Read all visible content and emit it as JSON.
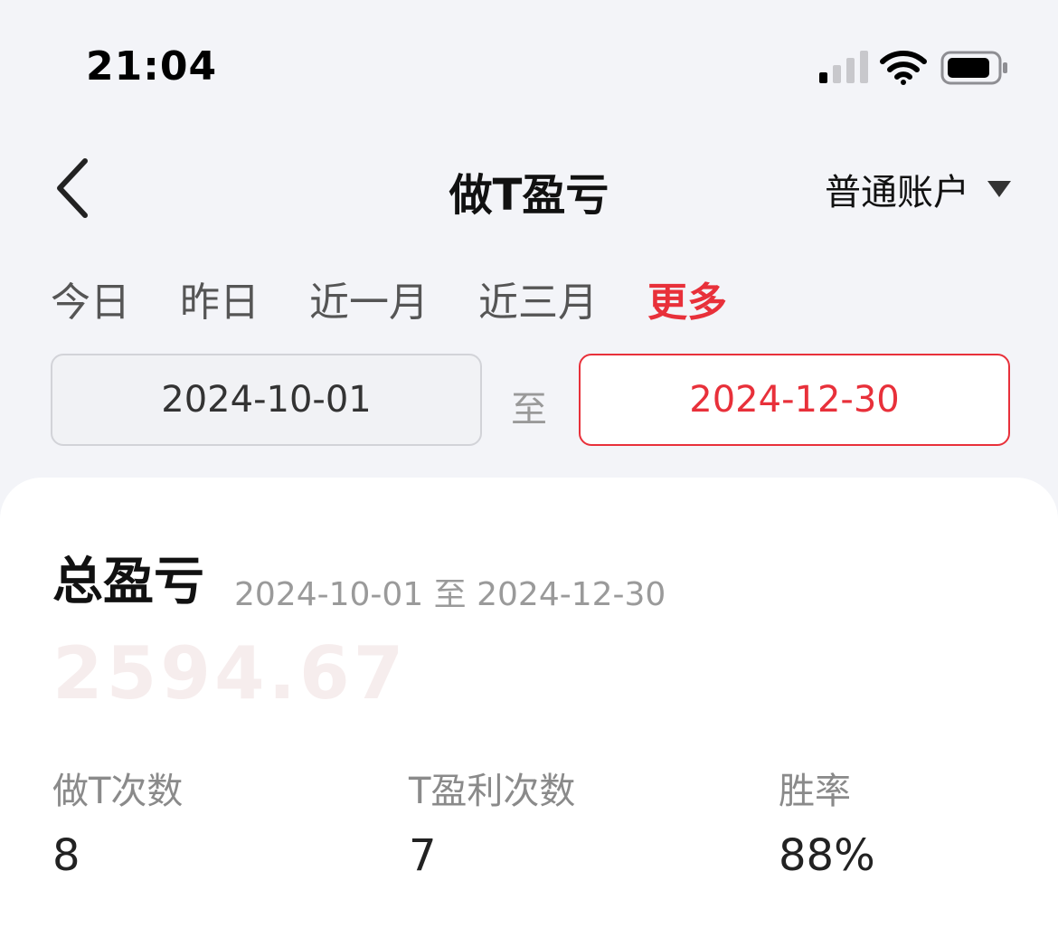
{
  "status_bar": {
    "time": "21:04",
    "icons": [
      "signal-icon",
      "wifi-icon",
      "battery-icon"
    ]
  },
  "nav": {
    "back_icon": "chevron-left-icon",
    "title": "做T盈亏",
    "account_label": "普通账户",
    "account_caret_icon": "caret-down-icon"
  },
  "range_tabs": [
    {
      "label": "今日",
      "active": false
    },
    {
      "label": "昨日",
      "active": false
    },
    {
      "label": "近一月",
      "active": false
    },
    {
      "label": "近三月",
      "active": false
    },
    {
      "label": "更多",
      "active": true
    }
  ],
  "date_range": {
    "start": "2024-10-01",
    "separator": "至",
    "end": "2024-12-30"
  },
  "summary": {
    "title": "总盈亏",
    "range_text": "2024-10-01 至 2024-12-30",
    "total_value": "2594.67",
    "stats": [
      {
        "label": "做T次数",
        "value": "8"
      },
      {
        "label": "T盈利次数",
        "value": "7"
      },
      {
        "label": "胜率",
        "value": "88%"
      }
    ]
  },
  "colors": {
    "accent": "#e8303a",
    "background": "#f3f4f8",
    "card": "#ffffff"
  }
}
